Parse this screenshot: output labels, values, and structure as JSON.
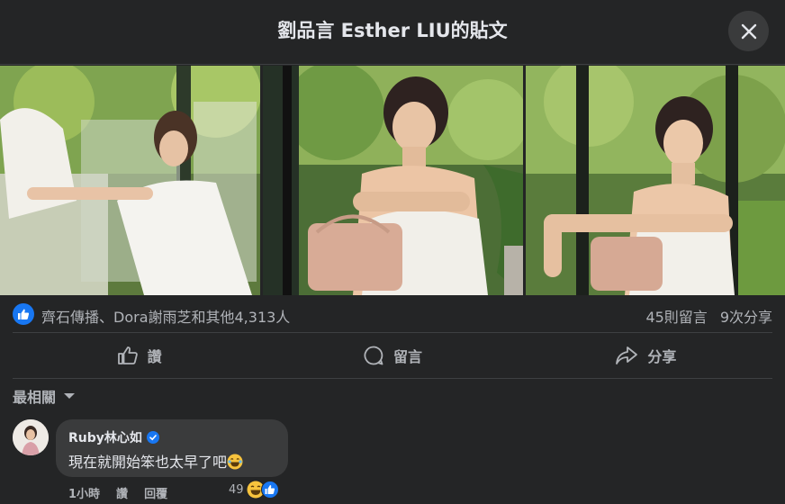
{
  "header": {
    "title": "劉品言 Esther LIU的貼文"
  },
  "stats": {
    "likers": "齊石傳播、Dora謝雨芝和其他4,313人",
    "comments": "45則留言",
    "shares": "9次分享"
  },
  "actions": {
    "like": "讚",
    "comment": "留言",
    "share": "分享"
  },
  "sort": {
    "label": "最相關"
  },
  "comment": {
    "author": "Ruby林心如",
    "text": "現在就開始笨也太早了吧",
    "time": "1小時",
    "like": "讚",
    "reply": "回覆",
    "reaction_count": "49"
  },
  "colors": {
    "accent": "#1877f2",
    "background": "#242526",
    "bubble": "#3a3b3c"
  },
  "icons": [
    "close-icon",
    "like-icon",
    "comment-icon",
    "share-icon",
    "chevron-down-icon",
    "verified-icon",
    "laughing-emoji-icon"
  ]
}
